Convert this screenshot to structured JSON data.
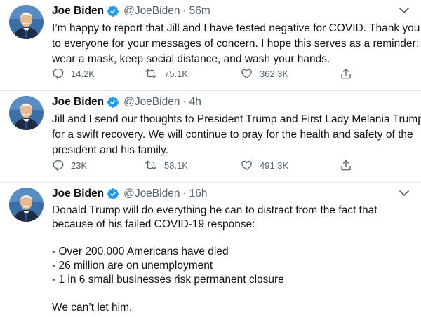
{
  "colors": {
    "text": "#0f1419",
    "muted": "#536471",
    "verified": "#1d9bf0",
    "divider": "#e1e8ed"
  },
  "tweets": [
    {
      "name": "Joe Biden",
      "handle": "@JoeBiden",
      "separator": "·",
      "time": "56m",
      "lines": [
        "I’m happy to report that Jill and I have tested negative for COVID. Thank you",
        "to everyone for your messages of concern. I hope this serves as a reminder:",
        "wear a mask, keep social distance, and wash your hands."
      ],
      "replies": "14.2K",
      "retweets": "75.1K",
      "likes": "362.3K"
    },
    {
      "name": "Joe Biden",
      "handle": "@JoeBiden",
      "separator": "·",
      "time": "4h",
      "lines": [
        "Jill and I send our thoughts to President Trump and First Lady Melania Trump",
        "for a swift recovery. We will continue to pray for the health and safety of the",
        "president and his family."
      ],
      "replies": "23K",
      "retweets": "58.1K",
      "likes": "491.3K"
    },
    {
      "name": "Joe Biden",
      "handle": "@JoeBiden",
      "separator": "·",
      "time": "16h",
      "lines": [
        "Donald Trump will do everything he can to distract from the fact that",
        "because of his failed COVID-19 response:",
        "",
        "- Over 200,000 Americans have died",
        "- 26 million are on unemployment",
        "- 1 in 6 small businesses risk permanent closure",
        "",
        "We can’t let him."
      ]
    }
  ]
}
